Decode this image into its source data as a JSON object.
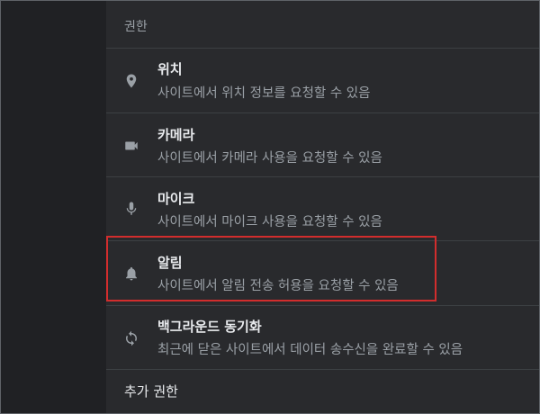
{
  "section_title": "권한",
  "permissions": [
    {
      "icon": "location-pin-icon",
      "title": "위치",
      "description": "사이트에서 위치 정보를 요청할 수 있음"
    },
    {
      "icon": "camera-icon",
      "title": "카메라",
      "description": "사이트에서 카메라 사용을 요청할 수 있음"
    },
    {
      "icon": "microphone-icon",
      "title": "마이크",
      "description": "사이트에서 마이크 사용을 요청할 수 있음"
    },
    {
      "icon": "bell-icon",
      "title": "알림",
      "description": "사이트에서 알림 전송 허용을 요청할 수 있음"
    },
    {
      "icon": "sync-icon",
      "title": "백그라운드 동기화",
      "description": "최근에 닫은 사이트에서 데이터 송수신을 완료할 수 있음"
    }
  ],
  "more_permissions_label": "추가 권한",
  "colors": {
    "panel_bg": "#292a2d",
    "rail_bg": "#202124",
    "title_text": "#e8eaed",
    "secondary_text": "#9aa0a6",
    "highlight_border": "#d22d2d"
  }
}
